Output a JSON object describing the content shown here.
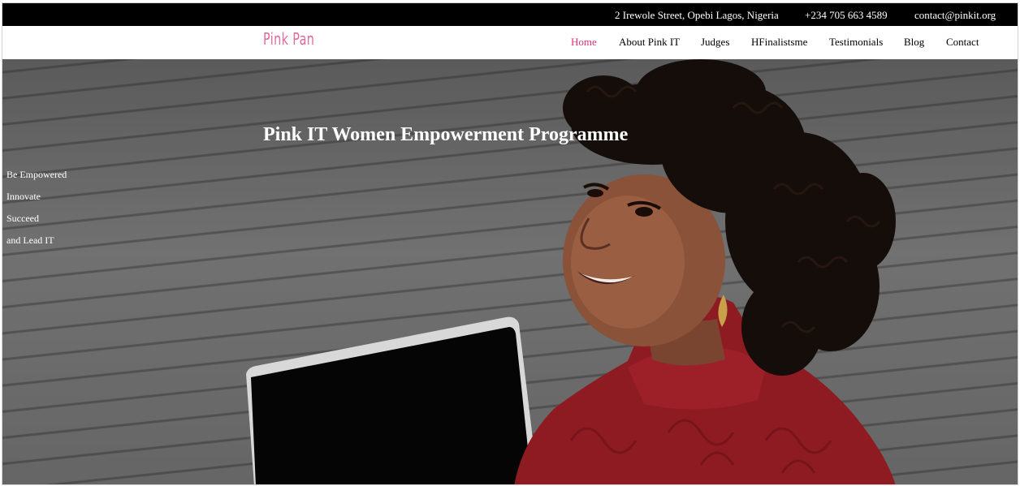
{
  "topbar": {
    "address": "2 Irewole Street, Opebi Lagos, Nigeria",
    "phone": "+234 705 663 4589",
    "email": "contact@pinkit.org"
  },
  "brand": {
    "logo_text": "Pink Pan",
    "accent_color": "#e0307a"
  },
  "nav": {
    "items": [
      {
        "label": "Home",
        "active": true
      },
      {
        "label": "About Pink IT",
        "active": false
      },
      {
        "label": "Judges",
        "active": false
      },
      {
        "label": "HFinalistsme",
        "active": false
      },
      {
        "label": "Testimonials",
        "active": false
      },
      {
        "label": "Blog",
        "active": false
      },
      {
        "label": "Contact",
        "active": false
      }
    ]
  },
  "hero": {
    "title": "Pink IT Women Empowerment Programme",
    "taglines": [
      "Be Empowered",
      "Innovate",
      "Succeed",
      "and Lead IT"
    ]
  }
}
